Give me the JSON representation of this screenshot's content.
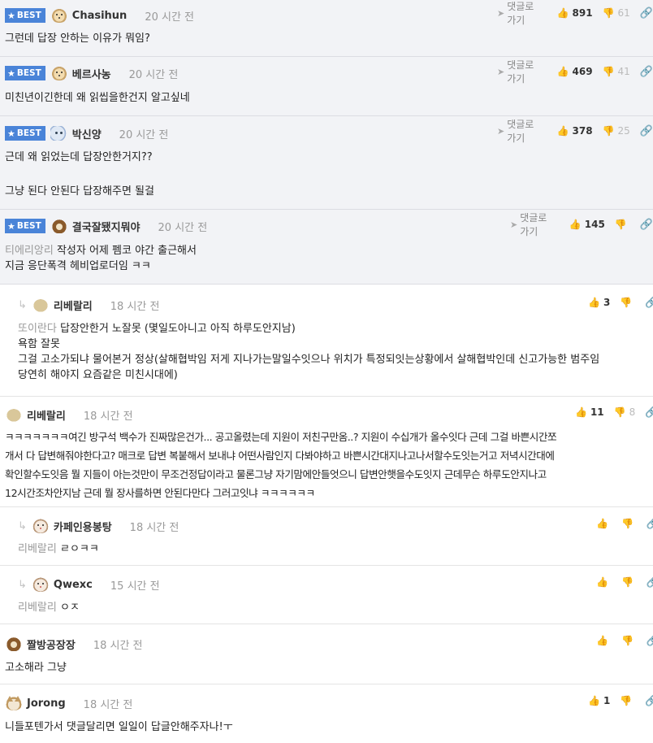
{
  "ui": {
    "best_label": "BEST",
    "goto_label": "댓글로 가기"
  },
  "comments": [
    {
      "nick": "Chasihun",
      "time": "20 시간 전",
      "up": "891",
      "down": "61",
      "lines": [
        "그런데 답장 안하는 이유가 뭐임?"
      ]
    },
    {
      "nick": "베르사농",
      "time": "20 시간 전",
      "up": "469",
      "down": "41",
      "lines": [
        "미친년이긴한데 왜 읽씹을한건지 알고싶네"
      ]
    },
    {
      "nick": "박신양",
      "time": "20 시간 전",
      "up": "378",
      "down": "25",
      "lines": [
        "근데 왜 읽었는데 답장안한거지??",
        "그냥 된다 안된다 답장해주면 될걸"
      ]
    },
    {
      "nick": "결국잘됐지뭐야",
      "time": "20 시간 전",
      "up": "145",
      "mention": "티에리앙리",
      "lines": [
        "작성자 어제 펨코 야간 출근해서",
        "지금 응단폭격 헤비업로더임 ㅋㅋ"
      ]
    },
    {
      "nick": "리베랄리",
      "time": "18 시간 전",
      "up": "3",
      "mention": "또이란다",
      "lines": [
        "답장안한거 노잘못 (몇일도아니고 아직 하루도안지남)",
        "욕함 잘못",
        "그걸 고소가되냐 물어본거 정상(살해협박임 저게 지나가는말일수잇으나 위치가 특정되잇는상황에서 살해협박인데 신고가능한 범주임",
        "당연히 해야지 요즘같은 미친시대에)"
      ]
    },
    {
      "nick": "리베랄리",
      "time": "18 시간 전",
      "up": "11",
      "down": "8",
      "lines": [
        "ㅋㅋㅋㅋㅋㅋㅋ여긴 방구석 백수가 진짜많은건가... 공고올렸는데 지원이 저친구만옴..? 지원이 수십개가 올수잇다 근데 그걸 바쁜시간쪼",
        "개서 다 답변해줘야한다고? 매크로 답변 복붙해서 보내냐 어떤사람인지 다봐야하고 바쁜시간대지나고나서할수도잇는거고 저녁시간대에",
        "확인할수도잇음 뭘 지들이 아는것만이 무조건정답이라고 물론그냥 자기맘에안들엇으니 답변안햇을수도잇지 근데무슨 하루도안지나고",
        "12시간조차안지남 근데 뭘 장사를하면 안된다만다 그러고잇냐 ㅋㅋㅋㅋㅋㅋ"
      ]
    },
    {
      "nick": "카페인용봉탕",
      "time": "18 시간 전",
      "mention": "리베랄리",
      "lines": [
        "ㄹㅇㅋㅋ"
      ]
    },
    {
      "nick": "Qwexc",
      "time": "15 시간 전",
      "mention": "리베랄리",
      "lines": [
        "ㅇㅈ"
      ]
    },
    {
      "nick": "짤방공장장",
      "time": "18 시간 전",
      "lines": [
        "고소해라 그냥"
      ]
    },
    {
      "nick": "Jorong",
      "time": "18 시간 전",
      "up": "1",
      "lines": [
        "니들포텐가서 댓글달리면 일일이 답글안해주자나!ㅜ"
      ]
    }
  ]
}
